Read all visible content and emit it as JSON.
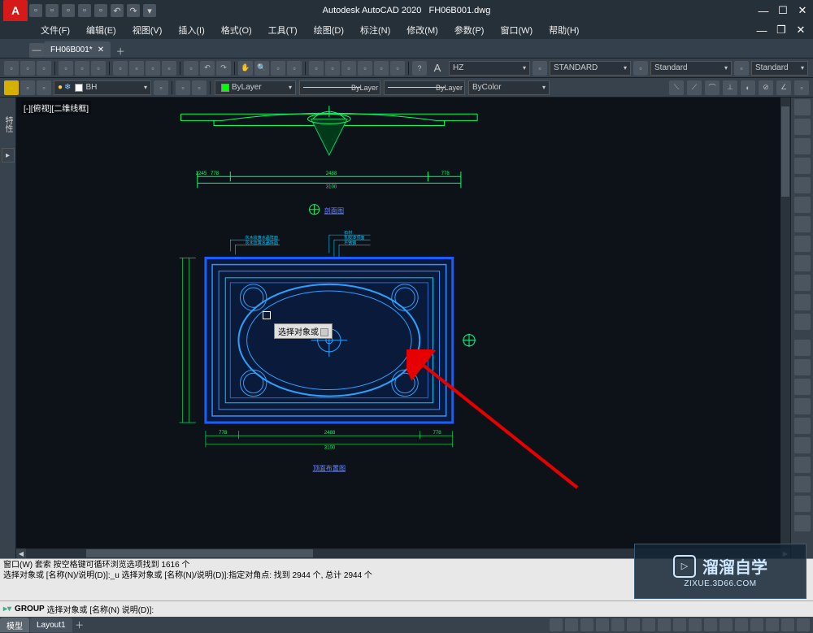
{
  "app": {
    "title_app": "Autodesk AutoCAD 2020",
    "title_doc": "FH06B001.dwg",
    "logo_text": "A"
  },
  "menus": [
    "文件(F)",
    "编辑(E)",
    "视图(V)",
    "插入(I)",
    "格式(O)",
    "工具(T)",
    "绘图(D)",
    "标注(N)",
    "修改(M)",
    "参数(P)",
    "窗口(W)",
    "帮助(H)"
  ],
  "doc_tab": {
    "label": "FH06B001*"
  },
  "toolbar2": {
    "text_style": "A",
    "font_style": "HZ",
    "dim_style": "STANDARD",
    "table_style": "Standard",
    "mleader_style": "Standard"
  },
  "layer": {
    "current": "BH",
    "linetype_color": "ByLayer",
    "lineweight": "ByLayer",
    "plot_style": "ByLayer",
    "color_control": "ByColor"
  },
  "view": {
    "label": "[-][俯视][二维线框]"
  },
  "tooltip": {
    "text": "选择对象或"
  },
  "drawing": {
    "section_label": "剖面图",
    "plan_label": "顶面布置图",
    "dimensions": {
      "overall": "2488",
      "total_width": "3100",
      "side": "778",
      "side2": "778",
      "height_note": "2245"
    },
    "notes": [
      "灰木纹黄水晶阵面",
      "石材",
      "乳胶漆顶面",
      "不锈钢",
      "灰木纹黄水晶阵面"
    ]
  },
  "command_history": [
    "窗口(W) 套索  按空格键可循环浏览选项找到 1616 个",
    "选择对象或 [名称(N)/说明(D)]:_u 选择对象或 [名称(N)/说明(D)]:指定对角点: 找到 2944 个, 总计 2944 个"
  ],
  "command_prompt": {
    "cmd": "GROUP",
    "text": "选择对象或 [名称(N) 说明(D)]:"
  },
  "bottom_tabs": [
    "模型",
    "Layout1"
  ],
  "watermark": {
    "title": "溜溜自学",
    "url": "ZIXUE.3D66.COM"
  }
}
